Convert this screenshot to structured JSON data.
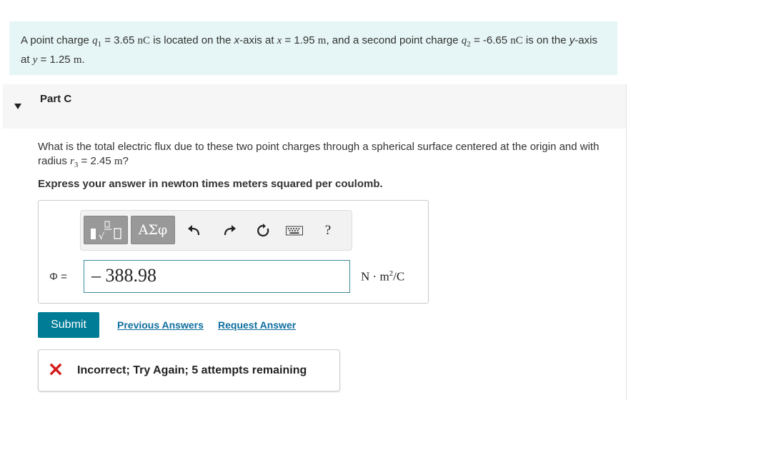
{
  "intro": {
    "p1": "A point charge ",
    "q1_sym": "q",
    "q1_sub": "1",
    "eq1": " = 3.65 ",
    "unit_nc1": "nC",
    "p2": " is located on the ",
    "x_axis": "x",
    "p3": "-axis at ",
    "x_var": "x",
    "eq2": " = 1.95 ",
    "unit_m1": "m",
    "p4": ", and a second point charge ",
    "q2_sym": "q",
    "q2_sub": "2",
    "eq3": " = -6.65 ",
    "unit_nc2": "nC",
    "p5": " is on the ",
    "y_axis": "y",
    "p6": "-axis at ",
    "y_var": "y",
    "eq4": " = 1.25 ",
    "unit_m2": "m",
    "p7": "."
  },
  "part": {
    "title": "Part C"
  },
  "question": {
    "p1": "What is the total electric flux due to these two point charges through a spherical surface centered at the origin and with radius ",
    "r_sym": "r",
    "r_sub": "3",
    "eq": " = 2.45 ",
    "unit": "m",
    "p2": "?"
  },
  "instruction": "Express your answer in newton times meters squared per coulomb.",
  "toolbar": {
    "symbols_label": "ΑΣφ",
    "help_label": "?",
    "icons": [
      "templates-icon",
      "greek-symbols-icon",
      "undo-icon",
      "redo-icon",
      "reset-icon",
      "keyboard-icon",
      "help-icon"
    ]
  },
  "answer": {
    "variable_label": "Φ =",
    "value": "– 388.98",
    "unit_base": "N · m",
    "unit_exp": "2",
    "unit_tail": "/C"
  },
  "actions": {
    "submit_label": "Submit",
    "previous_answers_label": "Previous Answers",
    "request_answer_label": "Request Answer"
  },
  "feedback": {
    "text": "Incorrect; Try Again; 5 attempts remaining",
    "status_color": "#d41c1c"
  },
  "colors": {
    "accent": "#007c97",
    "link": "#0e6e9e",
    "intro_bg": "#e6f5f5"
  }
}
